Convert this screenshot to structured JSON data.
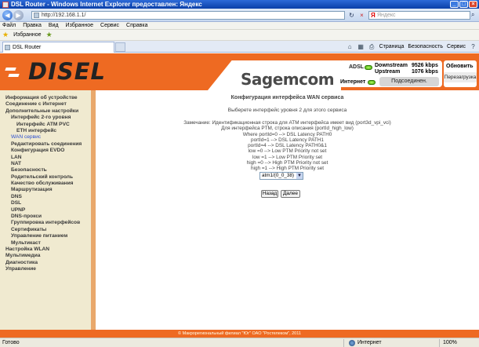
{
  "window": {
    "title": "DSL Router - Windows Internet Explorer предоставлен: Яндекс"
  },
  "address_bar": {
    "url": "http://192.168.1.1/",
    "search_placeholder": "Яндекс"
  },
  "menu": [
    "Файл",
    "Правка",
    "Вид",
    "Избранное",
    "Сервис",
    "Справка"
  ],
  "favorites": {
    "label": "Избранное"
  },
  "tab": {
    "label": "DSL Router"
  },
  "command_bar": {
    "page": "Страница",
    "security": "Безопасность",
    "tools": "Сервис"
  },
  "header": {
    "brand": "DISEL",
    "partner": "Sagemcom",
    "adsl_label": "ADSL",
    "downstream_label": "Downstream",
    "downstream_value": "9526 kbps",
    "upstream_label": "Upstream",
    "upstream_value": "1076 kbps",
    "internet_label": "Интернет",
    "connected_label": "Подсоединен.",
    "refresh_label": "Обновить",
    "reboot_label": "Перезагрузка"
  },
  "sidebar": {
    "items": [
      {
        "label": "Информация об устройстве",
        "level": 0
      },
      {
        "label": "Соединение с Интернет",
        "level": 0
      },
      {
        "label": "Дополнительные настройки",
        "level": 0
      },
      {
        "label": "Интерфейс 2-го уровня",
        "level": 1
      },
      {
        "label": "Интерфейс ATM PVC",
        "level": 2
      },
      {
        "label": "ETH интерфейс",
        "level": 2
      },
      {
        "label": "WAN сервис",
        "level": 1,
        "active": true
      },
      {
        "label": "Редактировать соединения",
        "level": 1
      },
      {
        "label": "Конфигурация EVDO",
        "level": 1
      },
      {
        "label": "LAN",
        "level": 1
      },
      {
        "label": "NAT",
        "level": 1
      },
      {
        "label": "Безопасность",
        "level": 1
      },
      {
        "label": "Родительский контроль",
        "level": 1
      },
      {
        "label": "Качество обслуживания",
        "level": 1
      },
      {
        "label": "Маршрутизация",
        "level": 1
      },
      {
        "label": "DNS",
        "level": 1
      },
      {
        "label": "DSL",
        "level": 1
      },
      {
        "label": "UPNP",
        "level": 1
      },
      {
        "label": "DNS-прокси",
        "level": 1
      },
      {
        "label": "Группировка интерфейсов",
        "level": 1
      },
      {
        "label": "Сертификаты",
        "level": 1
      },
      {
        "label": "Управление питанием",
        "level": 1
      },
      {
        "label": "Мультикаст",
        "level": 1
      },
      {
        "label": "Настройка WLAN",
        "level": 0
      },
      {
        "label": "Мультимедиа",
        "level": 0
      },
      {
        "label": "Диагностика",
        "level": 0
      },
      {
        "label": "Управление",
        "level": 0
      }
    ]
  },
  "main": {
    "title": "Конфигурация интерфейса WAN сервиса",
    "subtitle": "Выберете интерфейс уровня 2 для этого сервиса",
    "note_lines": [
      "Замечание: Идентификационная строка для ATM интерфейса имеет вид (port3d_vpi_vci)",
      "Для интерфейса PTM, строка описания (portId_high_low)",
      "Where portId=0 --> DSL Latency PATH0",
      "portId=1 --> DSL Latency PATH1",
      "portId=4 --> DSL Latency PATH0&1",
      "low =0 --> Low PTM Priority not set",
      "low =1 --> Low PTM Priority set",
      "high =0 --> High PTM Priority not set",
      "high =1 --> High PTM Priority set"
    ],
    "interface_selected": "atm1/(0_0_38)",
    "back_label": "Назад",
    "next_label": "Далее"
  },
  "footer": {
    "text": "© Макрорегиональный филиал \"Юг\" ОАО \"Ростелеком\", 2011"
  },
  "status_bar": {
    "ready": "Готово",
    "zone": "Интернет",
    "zoom": "100%"
  },
  "colors": {
    "accent": "#ee6a22",
    "sidebar_bg": "#f0ead0",
    "active_link": "#2b4ed0"
  }
}
